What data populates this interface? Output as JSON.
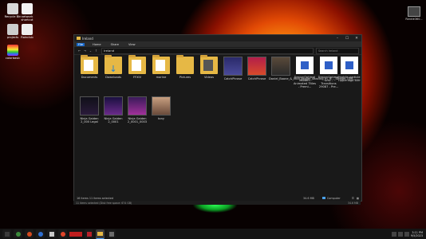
{
  "desktop": {
    "icons": [
      {
        "label": "Recycle Bin",
        "color": "#d8d8d8"
      },
      {
        "label": "network shortcut",
        "color": "#f2f2f2"
      },
      {
        "label": "projects",
        "color": "#cccccc"
      },
      {
        "label": "Rainclub",
        "color": "#eeeeee"
      },
      {
        "label": "colorbasic",
        "color": "#e83b8f"
      }
    ],
    "top_right_label": "Rankle360..."
  },
  "window": {
    "title": "Ireland",
    "ribbon_tabs": [
      "File",
      "Home",
      "Share",
      "View"
    ],
    "address_path": "Ireland",
    "search_placeholder": "Search Ireland",
    "items": [
      {
        "label": "Documents",
        "kind": "folder"
      },
      {
        "label": "Downloads",
        "kind": "folder-download"
      },
      {
        "label": "FFXIV",
        "kind": "folder"
      },
      {
        "label": "marine",
        "kind": "folder"
      },
      {
        "label": "Pictures",
        "kind": "folder"
      },
      {
        "label": "Videos",
        "kind": "folder"
      },
      {
        "label": "CatchPhrase",
        "kind": "media"
      },
      {
        "label": "CatchPhrase",
        "kind": "media"
      },
      {
        "label": "Daniel_Boone_&_Mick_Jagger_dancing_in_Tr..._Stream_(Off...",
        "kind": "media"
      },
      {
        "label": "DesignOptimal Modern Animated Titles - Premi...",
        "kind": "doc"
      },
      {
        "label": "DesignOptimal univ - Transitions 29087 - Pre...",
        "kind": "doc"
      },
      {
        "label": "mobile-particle ripple-logo 60fr",
        "kind": "doc"
      },
      {
        "label": "Ninja Gaiden 2_000 Legal",
        "kind": "media"
      },
      {
        "label": "Ninja Gaiden 2_0001",
        "kind": "media"
      },
      {
        "label": "Ninja Gaiden 2_0001_0003",
        "kind": "media"
      },
      {
        "label": "tony",
        "kind": "media"
      }
    ],
    "status_left": "16 items    11 items selected",
    "status_size": "34.6 MB",
    "status_location": "Computer"
  },
  "window_bar": {
    "left_text": "11 items selected (Disk free space: 674 GB)",
    "right_text": "34.6 MB"
  },
  "taskbar": {
    "clock_time": "3:11 PM",
    "clock_date": "9/5/2023"
  }
}
